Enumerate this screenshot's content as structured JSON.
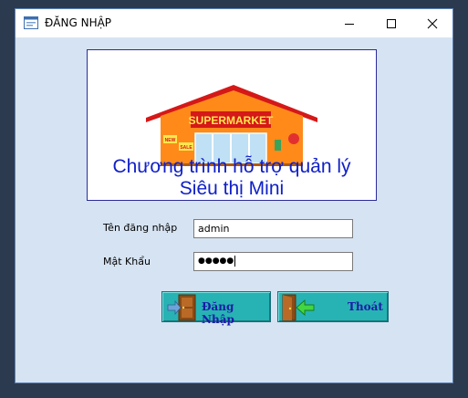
{
  "window": {
    "title": "ĐĂNG NHẬP",
    "controls": [
      "minimize",
      "maximize",
      "close"
    ]
  },
  "banner": {
    "store_sign": "SUPERMARKET",
    "tag_new": "NEW",
    "tag_sale": "SALE",
    "line1": "Chương trình hỗ trợ quản lý",
    "line2": "Siêu thị Mini",
    "text_color": "#1020c8"
  },
  "form": {
    "username_label": "Tên đăng nhập",
    "username_value": "admin",
    "password_label": "Mật Khẩu",
    "password_value": "●●●●●"
  },
  "buttons": {
    "login_label": "Đăng Nhập",
    "exit_label": "Thoát",
    "color": "#27b3b3"
  },
  "colors": {
    "window_bg": "#d6e3f2",
    "desktop_bg": "#2c3a4f"
  }
}
